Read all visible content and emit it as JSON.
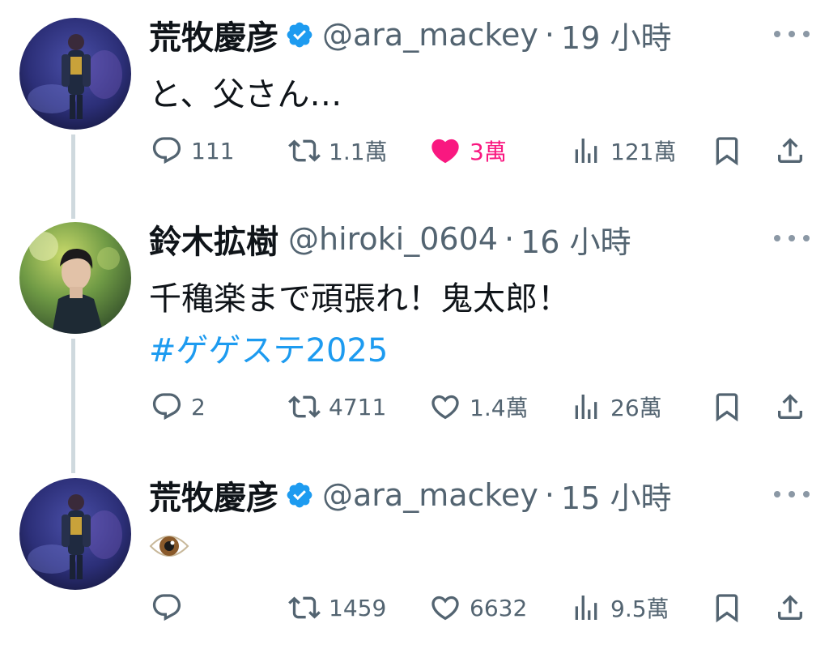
{
  "tweets": [
    {
      "display_name": "荒牧慶彦",
      "handle": "@ara_mackey",
      "separator": "·",
      "time": "19 小時",
      "text": "と、父さん…",
      "hashtag": "",
      "replies": "111",
      "retweets": "1.1萬",
      "likes": "3萬",
      "views": "121萬",
      "liked": true
    },
    {
      "display_name": "鈴木拡樹",
      "handle": "@hiroki_0604",
      "separator": "·",
      "time": "16 小時",
      "text": "千穐楽まで頑張れ！鬼太郎！",
      "hashtag": "#ゲゲステ2025",
      "replies": "2",
      "retweets": "4711",
      "likes": "1.4萬",
      "views": "26萬",
      "liked": false
    },
    {
      "display_name": "荒牧慶彦",
      "handle": "@ara_mackey",
      "separator": "·",
      "time": "15 小時",
      "text": "👁️",
      "hashtag": "",
      "replies": "",
      "retweets": "1459",
      "likes": "6632",
      "views": "9.5萬",
      "liked": false
    }
  ],
  "colors": {
    "text": "#0f1419",
    "secondary": "#536471",
    "link": "#1d9bf0",
    "like": "#f91880",
    "verified": "#1d9bf0",
    "thread_line": "#cfd9de"
  }
}
